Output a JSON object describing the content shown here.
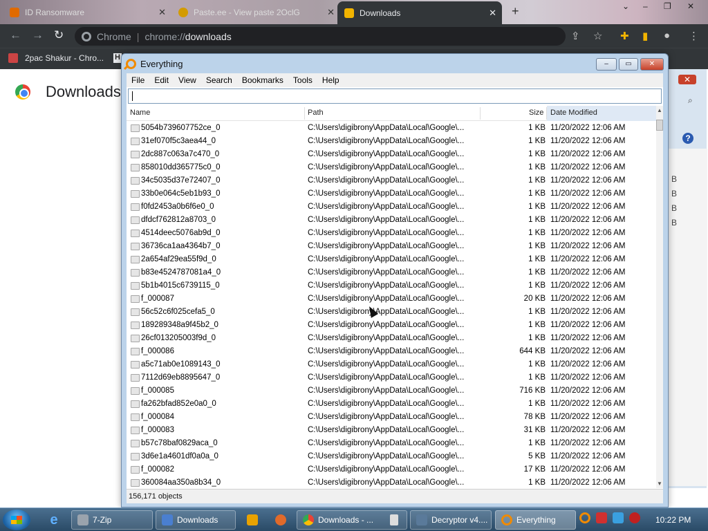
{
  "browser": {
    "tabs": [
      {
        "label": "ID Ransomware",
        "color": "#e06a00"
      },
      {
        "label": "Paste.ee - View paste 2OclG",
        "color": "#d39b00"
      },
      {
        "label": "Downloads",
        "color": "#f2b400",
        "active": true
      }
    ],
    "new_tab": "+",
    "window_controls": [
      "⌄",
      "–",
      "❐",
      "✕"
    ],
    "omnibox": {
      "site": "Chrome",
      "url_prefix": "chrome://",
      "url_path": "downloads"
    },
    "bookmarks": [
      {
        "label": "2pac Shakur - Chro..."
      }
    ],
    "page_title": "Downloads"
  },
  "everything": {
    "title": "Everything",
    "menu": [
      "File",
      "Edit",
      "View",
      "Search",
      "Bookmarks",
      "Tools",
      "Help"
    ],
    "search_value": "",
    "columns": {
      "name": "Name",
      "path": "Path",
      "size": "Size",
      "date": "Date Modified"
    },
    "rows": [
      {
        "name": "5054b739607752ce_0",
        "path": "C:\\Users\\digibrony\\AppData\\Local\\Google\\...",
        "size": "1 KB",
        "date": "11/20/2022 12:06 AM"
      },
      {
        "name": "31ef070f5c3aea44_0",
        "path": "C:\\Users\\digibrony\\AppData\\Local\\Google\\...",
        "size": "1 KB",
        "date": "11/20/2022 12:06 AM"
      },
      {
        "name": "2dc887c063a7c470_0",
        "path": "C:\\Users\\digibrony\\AppData\\Local\\Google\\...",
        "size": "1 KB",
        "date": "11/20/2022 12:06 AM"
      },
      {
        "name": "858010dd365775c0_0",
        "path": "C:\\Users\\digibrony\\AppData\\Local\\Google\\...",
        "size": "1 KB",
        "date": "11/20/2022 12:06 AM"
      },
      {
        "name": "34c5035d37e72407_0",
        "path": "C:\\Users\\digibrony\\AppData\\Local\\Google\\...",
        "size": "1 KB",
        "date": "11/20/2022 12:06 AM"
      },
      {
        "name": "33b0e064c5eb1b93_0",
        "path": "C:\\Users\\digibrony\\AppData\\Local\\Google\\...",
        "size": "1 KB",
        "date": "11/20/2022 12:06 AM"
      },
      {
        "name": "f0fd2453a0b6f6e0_0",
        "path": "C:\\Users\\digibrony\\AppData\\Local\\Google\\...",
        "size": "1 KB",
        "date": "11/20/2022 12:06 AM"
      },
      {
        "name": "dfdcf762812a8703_0",
        "path": "C:\\Users\\digibrony\\AppData\\Local\\Google\\...",
        "size": "1 KB",
        "date": "11/20/2022 12:06 AM"
      },
      {
        "name": "4514deec5076ab9d_0",
        "path": "C:\\Users\\digibrony\\AppData\\Local\\Google\\...",
        "size": "1 KB",
        "date": "11/20/2022 12:06 AM"
      },
      {
        "name": "36736ca1aa4364b7_0",
        "path": "C:\\Users\\digibrony\\AppData\\Local\\Google\\...",
        "size": "1 KB",
        "date": "11/20/2022 12:06 AM"
      },
      {
        "name": "2a654af29ea55f9d_0",
        "path": "C:\\Users\\digibrony\\AppData\\Local\\Google\\...",
        "size": "1 KB",
        "date": "11/20/2022 12:06 AM"
      },
      {
        "name": "b83e4524787081a4_0",
        "path": "C:\\Users\\digibrony\\AppData\\Local\\Google\\...",
        "size": "1 KB",
        "date": "11/20/2022 12:06 AM"
      },
      {
        "name": "5b1b4015c6739115_0",
        "path": "C:\\Users\\digibrony\\AppData\\Local\\Google\\...",
        "size": "1 KB",
        "date": "11/20/2022 12:06 AM"
      },
      {
        "name": "f_000087",
        "path": "C:\\Users\\digibrony\\AppData\\Local\\Google\\...",
        "size": "20 KB",
        "date": "11/20/2022 12:06 AM"
      },
      {
        "name": "56c52c6f025cefa5_0",
        "path": "C:\\Users\\digibrony\\AppData\\Local\\Google\\...",
        "size": "1 KB",
        "date": "11/20/2022 12:06 AM"
      },
      {
        "name": "189289348a9f45b2_0",
        "path": "C:\\Users\\digibrony\\AppData\\Local\\Google\\...",
        "size": "1 KB",
        "date": "11/20/2022 12:06 AM"
      },
      {
        "name": "26cf013205003f9d_0",
        "path": "C:\\Users\\digibrony\\AppData\\Local\\Google\\...",
        "size": "1 KB",
        "date": "11/20/2022 12:06 AM"
      },
      {
        "name": "f_000086",
        "path": "C:\\Users\\digibrony\\AppData\\Local\\Google\\...",
        "size": "644 KB",
        "date": "11/20/2022 12:06 AM"
      },
      {
        "name": "a5c71ab0e1089143_0",
        "path": "C:\\Users\\digibrony\\AppData\\Local\\Google\\...",
        "size": "1 KB",
        "date": "11/20/2022 12:06 AM"
      },
      {
        "name": "7112d69eb8895647_0",
        "path": "C:\\Users\\digibrony\\AppData\\Local\\Google\\...",
        "size": "1 KB",
        "date": "11/20/2022 12:06 AM"
      },
      {
        "name": "f_000085",
        "path": "C:\\Users\\digibrony\\AppData\\Local\\Google\\...",
        "size": "716 KB",
        "date": "11/20/2022 12:06 AM"
      },
      {
        "name": "fa262bfad852e0a0_0",
        "path": "C:\\Users\\digibrony\\AppData\\Local\\Google\\...",
        "size": "1 KB",
        "date": "11/20/2022 12:06 AM"
      },
      {
        "name": "f_000084",
        "path": "C:\\Users\\digibrony\\AppData\\Local\\Google\\...",
        "size": "78 KB",
        "date": "11/20/2022 12:06 AM"
      },
      {
        "name": "f_000083",
        "path": "C:\\Users\\digibrony\\AppData\\Local\\Google\\...",
        "size": "31 KB",
        "date": "11/20/2022 12:06 AM"
      },
      {
        "name": "b57c78baf0829aca_0",
        "path": "C:\\Users\\digibrony\\AppData\\Local\\Google\\...",
        "size": "1 KB",
        "date": "11/20/2022 12:06 AM"
      },
      {
        "name": "3d6e1a4601df0a0a_0",
        "path": "C:\\Users\\digibrony\\AppData\\Local\\Google\\...",
        "size": "5 KB",
        "date": "11/20/2022 12:06 AM"
      },
      {
        "name": "f_000082",
        "path": "C:\\Users\\digibrony\\AppData\\Local\\Google\\...",
        "size": "17 KB",
        "date": "11/20/2022 12:06 AM"
      },
      {
        "name": "360084aa350a8b34_0",
        "path": "C:\\Users\\digibrony\\AppData\\Local\\Google\\...",
        "size": "1 KB",
        "date": "11/20/2022 12:06 AM"
      }
    ],
    "status": "156,171 objects"
  },
  "background_window": {
    "size_suffixes": [
      "B",
      "B",
      "B",
      "B"
    ]
  },
  "taskbar": {
    "items": [
      {
        "label": "7-Zip",
        "icon_color": "#9aa3ad"
      },
      {
        "label": "Downloads",
        "icon_color": "#4a7fd0"
      },
      {
        "label": "Downloads - ...",
        "icon_color": "#db4437"
      },
      {
        "label": "Decryptor v4....",
        "icon_color": "#5a7a9a"
      },
      {
        "label": "Everything",
        "icon_color": "#f08a00"
      }
    ],
    "clock": "10:22 PM"
  }
}
